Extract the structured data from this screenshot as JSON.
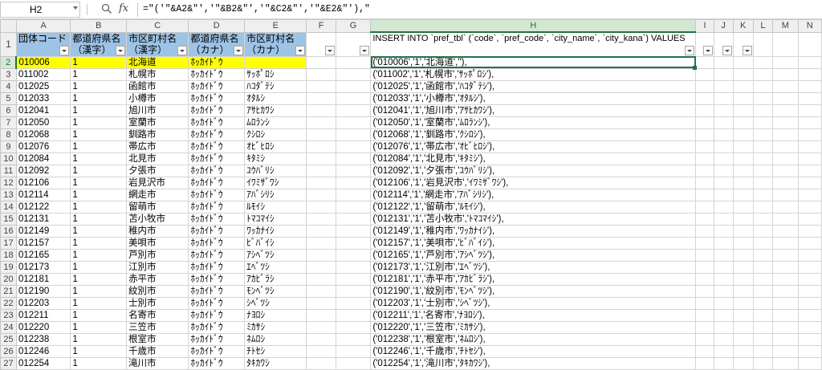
{
  "namebox": "H2",
  "formula": "=\"('\"&A2&\"','\"&B2&\"','\"&C2&\"','\"&E2&\"'),\"",
  "columns": [
    "A",
    "B",
    "C",
    "D",
    "E",
    "F",
    "G",
    "H",
    "I",
    "J",
    "K",
    "L",
    "M",
    "N"
  ],
  "headers": {
    "A": "団体コード",
    "B": "都道府県名\n（漢字）",
    "C": "市区町村名\n（漢字）",
    "D": "都道府県名\n（カナ）",
    "E": "市区町村名\n（カナ）",
    "H": "INSERT INTO `pref_tbl` (`code`, `pref_code`, `city_name`, `city_kana`) VALUES"
  },
  "rows": [
    {
      "n": "2",
      "a": "010006",
      "b": "1",
      "c": "北海道",
      "d": "ﾎｯｶｲﾄﾞｳ",
      "e": "",
      "h": "('010006','1','北海道',''),"
    },
    {
      "n": "3",
      "a": "011002",
      "b": "1",
      "c": "札幌市",
      "d": "ﾎｯｶｲﾄﾞｳ",
      "e": "ｻｯﾎﾟﾛｼ",
      "h": "('011002','1','札幌市','ｻｯﾎﾟﾛｼ'),"
    },
    {
      "n": "4",
      "a": "012025",
      "b": "1",
      "c": "函館市",
      "d": "ﾎｯｶｲﾄﾞｳ",
      "e": "ﾊｺﾀﾞﾃｼ",
      "h": "('012025','1','函館市','ﾊｺﾀﾞﾃｼ'),"
    },
    {
      "n": "5",
      "a": "012033",
      "b": "1",
      "c": "小樽市",
      "d": "ﾎｯｶｲﾄﾞｳ",
      "e": "ｵﾀﾙｼ",
      "h": "('012033','1','小樽市','ｵﾀﾙｼ'),"
    },
    {
      "n": "6",
      "a": "012041",
      "b": "1",
      "c": "旭川市",
      "d": "ﾎｯｶｲﾄﾞｳ",
      "e": "ｱｻﾋｶﾜｼ",
      "h": "('012041','1','旭川市','ｱｻﾋｶﾜｼ'),"
    },
    {
      "n": "7",
      "a": "012050",
      "b": "1",
      "c": "室蘭市",
      "d": "ﾎｯｶｲﾄﾞｳ",
      "e": "ﾑﾛﾗﾝｼ",
      "h": "('012050','1','室蘭市','ﾑﾛﾗﾝｼ'),"
    },
    {
      "n": "8",
      "a": "012068",
      "b": "1",
      "c": "釧路市",
      "d": "ﾎｯｶｲﾄﾞｳ",
      "e": "ｸｼﾛｼ",
      "h": "('012068','1','釧路市','ｸｼﾛｼ'),"
    },
    {
      "n": "9",
      "a": "012076",
      "b": "1",
      "c": "帯広市",
      "d": "ﾎｯｶｲﾄﾞｳ",
      "e": "ｵﾋﾞﾋﾛｼ",
      "h": "('012076','1','帯広市','ｵﾋﾞﾋﾛｼ'),"
    },
    {
      "n": "10",
      "a": "012084",
      "b": "1",
      "c": "北見市",
      "d": "ﾎｯｶｲﾄﾞｳ",
      "e": "ｷﾀﾐｼ",
      "h": "('012084','1','北見市','ｷﾀﾐｼ'),"
    },
    {
      "n": "11",
      "a": "012092",
      "b": "1",
      "c": "夕張市",
      "d": "ﾎｯｶｲﾄﾞｳ",
      "e": "ﾕｳﾊﾞﾘｼ",
      "h": "('012092','1','夕張市','ﾕｳﾊﾞﾘｼ'),"
    },
    {
      "n": "12",
      "a": "012106",
      "b": "1",
      "c": "岩見沢市",
      "d": "ﾎｯｶｲﾄﾞｳ",
      "e": "ｲﾜﾐｻﾞﾜｼ",
      "h": "('012106','1','岩見沢市','ｲﾜﾐｻﾞﾜｼ'),"
    },
    {
      "n": "13",
      "a": "012114",
      "b": "1",
      "c": "網走市",
      "d": "ﾎｯｶｲﾄﾞｳ",
      "e": "ｱﾊﾞｼﾘｼ",
      "h": "('012114','1','網走市','ｱﾊﾞｼﾘｼ'),"
    },
    {
      "n": "14",
      "a": "012122",
      "b": "1",
      "c": "留萌市",
      "d": "ﾎｯｶｲﾄﾞｳ",
      "e": "ﾙﾓｲｼ",
      "h": "('012122','1','留萌市','ﾙﾓｲｼ'),"
    },
    {
      "n": "15",
      "a": "012131",
      "b": "1",
      "c": "苫小牧市",
      "d": "ﾎｯｶｲﾄﾞｳ",
      "e": "ﾄﾏｺﾏｲｼ",
      "h": "('012131','1','苫小牧市','ﾄﾏｺﾏｲｼ'),"
    },
    {
      "n": "16",
      "a": "012149",
      "b": "1",
      "c": "稚内市",
      "d": "ﾎｯｶｲﾄﾞｳ",
      "e": "ﾜｯｶﾅｲｼ",
      "h": "('012149','1','稚内市','ﾜｯｶﾅｲｼ'),"
    },
    {
      "n": "17",
      "a": "012157",
      "b": "1",
      "c": "美唄市",
      "d": "ﾎｯｶｲﾄﾞｳ",
      "e": "ﾋﾞﾊﾞｲｼ",
      "h": "('012157','1','美唄市','ﾋﾞﾊﾞｲｼ'),"
    },
    {
      "n": "18",
      "a": "012165",
      "b": "1",
      "c": "芦別市",
      "d": "ﾎｯｶｲﾄﾞｳ",
      "e": "ｱｼﾍﾞﾂｼ",
      "h": "('012165','1','芦別市','ｱｼﾍﾞﾂｼ'),"
    },
    {
      "n": "19",
      "a": "012173",
      "b": "1",
      "c": "江別市",
      "d": "ﾎｯｶｲﾄﾞｳ",
      "e": "ｴﾍﾞﾂｼ",
      "h": "('012173','1','江別市','ｴﾍﾞﾂｼ'),"
    },
    {
      "n": "20",
      "a": "012181",
      "b": "1",
      "c": "赤平市",
      "d": "ﾎｯｶｲﾄﾞｳ",
      "e": "ｱｶﾋﾞﾗｼ",
      "h": "('012181','1','赤平市','ｱｶﾋﾞﾗｼ'),"
    },
    {
      "n": "21",
      "a": "012190",
      "b": "1",
      "c": "紋別市",
      "d": "ﾎｯｶｲﾄﾞｳ",
      "e": "ﾓﾝﾍﾞﾂｼ",
      "h": "('012190','1','紋別市','ﾓﾝﾍﾞﾂｼ'),"
    },
    {
      "n": "22",
      "a": "012203",
      "b": "1",
      "c": "士別市",
      "d": "ﾎｯｶｲﾄﾞｳ",
      "e": "ｼﾍﾞﾂｼ",
      "h": "('012203','1','士別市','ｼﾍﾞﾂｼ'),"
    },
    {
      "n": "23",
      "a": "012211",
      "b": "1",
      "c": "名寄市",
      "d": "ﾎｯｶｲﾄﾞｳ",
      "e": "ﾅﾖﾛｼ",
      "h": "('012211','1','名寄市','ﾅﾖﾛｼ'),"
    },
    {
      "n": "24",
      "a": "012220",
      "b": "1",
      "c": "三笠市",
      "d": "ﾎｯｶｲﾄﾞｳ",
      "e": "ﾐｶｻｼ",
      "h": "('012220','1','三笠市','ﾐｶｻｼ'),"
    },
    {
      "n": "25",
      "a": "012238",
      "b": "1",
      "c": "根室市",
      "d": "ﾎｯｶｲﾄﾞｳ",
      "e": "ﾈﾑﾛｼ",
      "h": "('012238','1','根室市','ﾈﾑﾛｼ'),"
    },
    {
      "n": "26",
      "a": "012246",
      "b": "1",
      "c": "千歳市",
      "d": "ﾎｯｶｲﾄﾞｳ",
      "e": "ﾁﾄｾｼ",
      "h": "('012246','1','千歳市','ﾁﾄｾｼ'),"
    },
    {
      "n": "27",
      "a": "012254",
      "b": "1",
      "c": "滝川市",
      "d": "ﾎｯｶｲﾄﾞｳ",
      "e": "ﾀｷｶﾜｼ",
      "h": "('012254','1','滝川市','ﾀｷｶﾜｼ'),"
    }
  ]
}
